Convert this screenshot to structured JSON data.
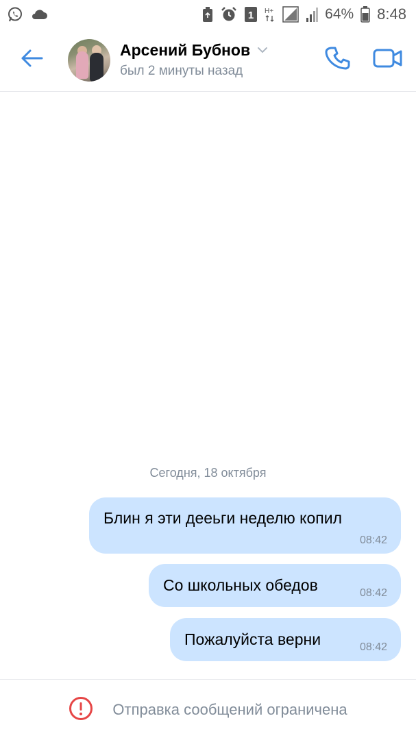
{
  "status_bar": {
    "battery_percent": "64%",
    "time": "8:48",
    "sim_badge": "1",
    "network_type": "H+",
    "left_icons": [
      "whatsapp-icon",
      "cloud-icon"
    ],
    "right_icons": [
      "recycle-icon",
      "alarm-icon",
      "sim-icon",
      "signal-icon",
      "signal-icon",
      "battery-icon"
    ]
  },
  "header": {
    "contact_name": "Арсений Бубнов",
    "last_seen": "был 2 минуты назад",
    "back_icon": "arrow-left-icon",
    "call_icon": "phone-icon",
    "video_icon": "video-camera-icon",
    "accent_color": "#3f8ae0"
  },
  "chat": {
    "date_separator": "Сегодня, 18 октября",
    "bubble_color": "#cce4ff",
    "messages": [
      {
        "text": "Блин я эти дееьги неделю копил",
        "time": "08:42",
        "outgoing": true
      },
      {
        "text": "Со школьных обедов",
        "time": "08:42",
        "outgoing": true
      },
      {
        "text": "Пожалуйста верни",
        "time": "08:42",
        "outgoing": true
      }
    ]
  },
  "footer": {
    "restricted_text": "Отправка сообщений ограничена",
    "warning_color": "#e64646"
  }
}
